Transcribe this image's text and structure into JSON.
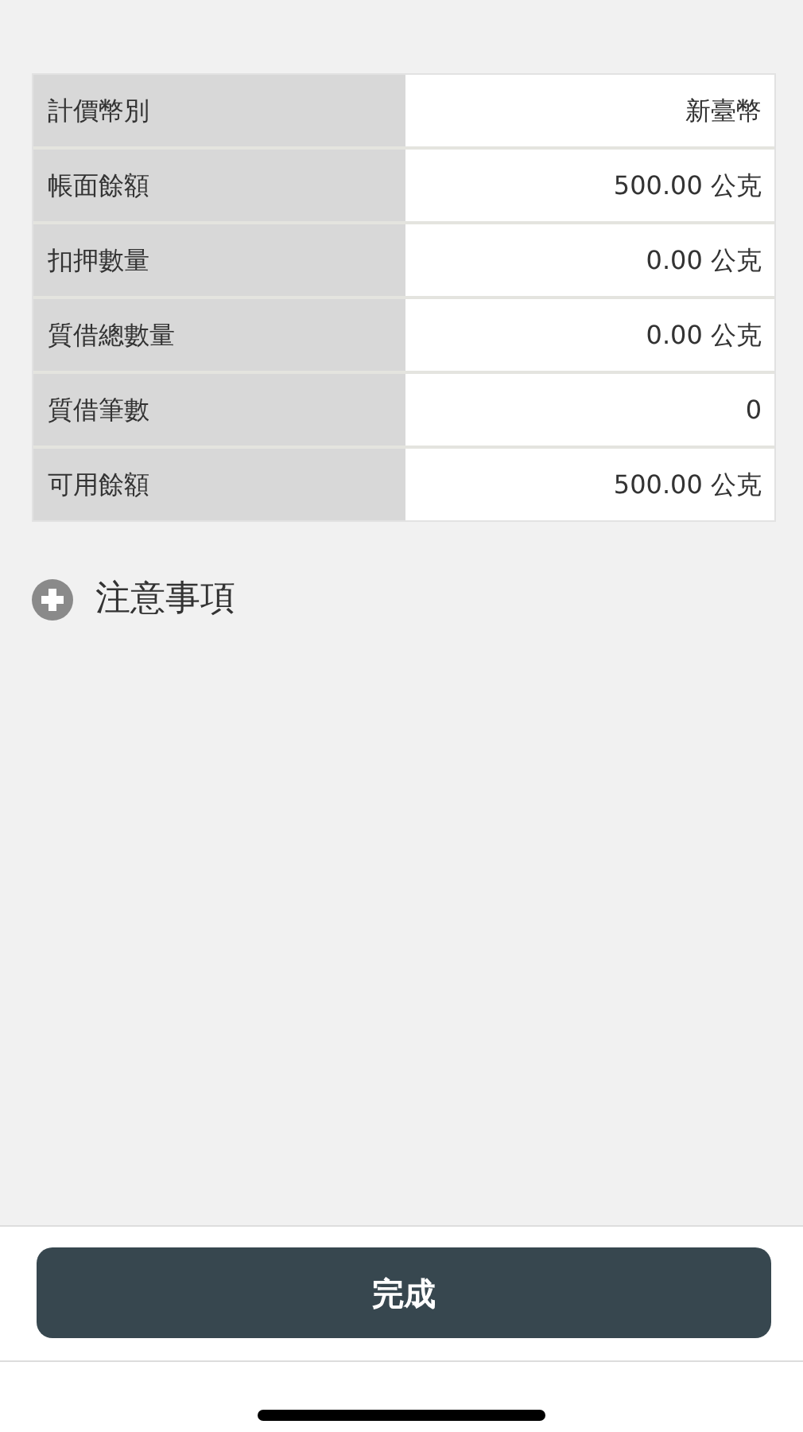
{
  "details": [
    {
      "label": "計價幣別",
      "value": "新臺幣"
    },
    {
      "label": "帳面餘額",
      "value": "500.00 公克"
    },
    {
      "label": "扣押數量",
      "value": "0.00 公克"
    },
    {
      "label": "質借總數量",
      "value": "0.00 公克"
    },
    {
      "label": "質借筆數",
      "value": "0"
    },
    {
      "label": "可用餘額",
      "value": "500.00 公克"
    }
  ],
  "notes": {
    "title": "注意事項",
    "expanded": false
  },
  "done_button": "完成"
}
